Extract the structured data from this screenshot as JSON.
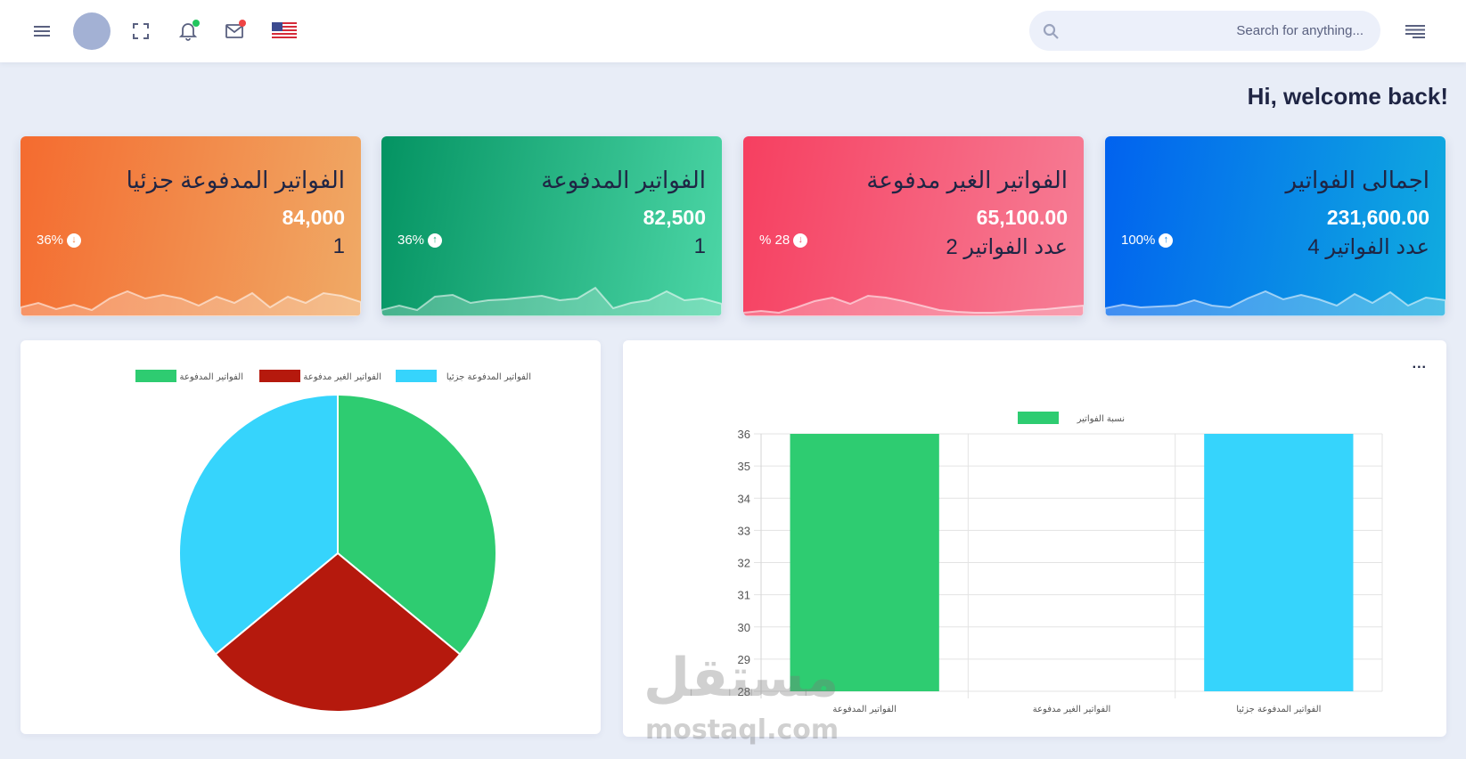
{
  "header": {
    "search_placeholder": "Search for anything...",
    "icons": [
      "menu-icon",
      "avatar",
      "fullscreen-icon",
      "bell-icon",
      "mail-icon",
      "us-flag-icon",
      "search-icon",
      "lines-icon"
    ]
  },
  "welcome": "Hi, welcome back!",
  "cards": [
    {
      "title": "الفواتير المدفوعة جزئيا",
      "amount": "84,000",
      "count": "1",
      "pct": "36%",
      "trend": "down",
      "color_start": "#f46b2f",
      "color_end": "#f0aa66"
    },
    {
      "title": "الفواتير المدفوعة",
      "amount": "82,500",
      "count": "1",
      "pct": "36%",
      "trend": "up",
      "color_start": "#049362",
      "color_end": "#4cd6a6"
    },
    {
      "title": "الفواتير الغير مدفوعة",
      "amount": "65,100.00",
      "count": "عدد الفواتير 2",
      "pct": "% 28",
      "trend": "down",
      "color_start": "#f63f60",
      "color_end": "#f67e96"
    },
    {
      "title": "اجمالى الفواتير",
      "amount": "231,600.00",
      "count": "عدد الفواتير 4",
      "pct": "100%",
      "trend": "up",
      "color_start": "#0162ef",
      "color_end": "#10acdf"
    }
  ],
  "pie_panel": {
    "legend": [
      "الفواتير المدفوعة",
      "الفواتير الغير مدفوعة",
      "الفواتير المدفوعة جزئيا"
    ]
  },
  "bar_panel": {
    "more_label": "...",
    "legend": "نسبة الفواتير"
  },
  "watermark": {
    "arabic": "مستقل",
    "latin": "mostaql.com"
  },
  "chart_data": [
    {
      "type": "pie",
      "categories": [
        "الفواتير المدفوعة",
        "الفواتير الغير مدفوعة",
        "الفواتير المدفوعة جزئيا"
      ],
      "values": [
        36,
        28,
        36
      ],
      "colors": [
        "#2ecc71",
        "#b5190d",
        "#36d4fc"
      ],
      "legend": "top"
    },
    {
      "type": "bar",
      "categories": [
        "الفواتير المدفوعة",
        "الفواتير الغير مدفوعة",
        "الفواتير المدفوعة جزئيا"
      ],
      "series": [
        {
          "name": "نسبة الفواتير",
          "values": [
            36,
            28,
            36
          ]
        }
      ],
      "colors": [
        "#2ecc71",
        "#b5190d",
        "#36d4fc"
      ],
      "ylim": [
        28,
        36
      ],
      "yticks": [
        28,
        29,
        30,
        31,
        32,
        33,
        34,
        35,
        36
      ],
      "grid": true,
      "legend": "top"
    }
  ]
}
